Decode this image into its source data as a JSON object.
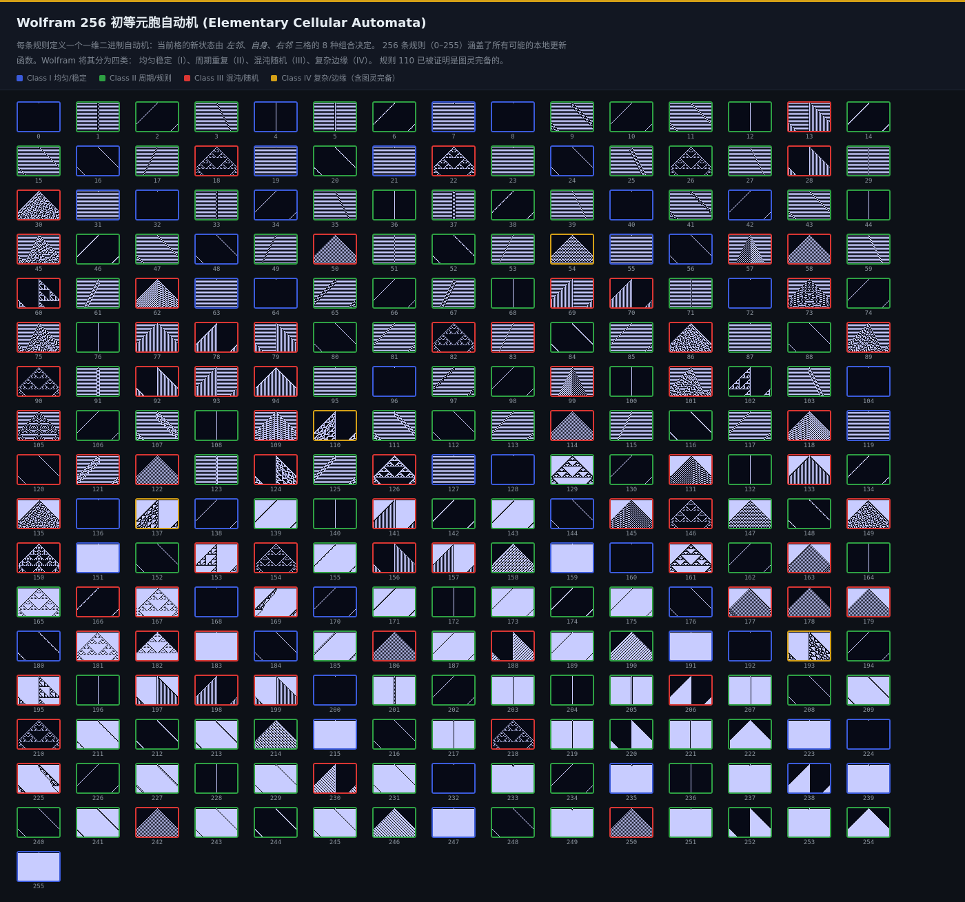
{
  "header": {
    "title": "Wolfram 256 初等元胞自动机 (Elementary Cellular Automata)",
    "desc_part1": "每条规则定义一个一维二进制自动机：当前格的新状态由 ",
    "desc_left": "左邻",
    "desc_sep1": "、",
    "desc_self": "自身",
    "desc_sep2": "、",
    "desc_right": "右邻",
    "desc_part2": " 三格的 8 种组合决定。 256 条规则（0–255）涵盖了所有可能的本地更新函数。Wolfram 将其分为四类： 均匀稳定（I）、周期重复（II）、混沌随机（III）、复杂边缘（IV）。 规则 110 已被证明是图灵完备的。"
  },
  "legend": [
    {
      "label": "Class I  均匀/稳定",
      "color": "#3b5bdb"
    },
    {
      "label": "Class II 周期/规则",
      "color": "#2ea043"
    },
    {
      "label": "Class III 混沌/随机",
      "color": "#da3633"
    },
    {
      "label": "Class IV 复杂/边缘（含图灵完备）",
      "color": "#d4a017"
    }
  ],
  "class_colors": {
    "1": "#3b5bdb",
    "2": "#2ea043",
    "3": "#da3633",
    "4": "#d4a017"
  },
  "cell_colors": {
    "on": "#c8ccff",
    "off": "#070a16"
  },
  "class3_rules": [
    13,
    18,
    22,
    28,
    30,
    45,
    50,
    57,
    58,
    60,
    62,
    69,
    70,
    73,
    75,
    77,
    78,
    79,
    82,
    83,
    86,
    89,
    90,
    92,
    93,
    94,
    99,
    101,
    105,
    109,
    114,
    118,
    120,
    121,
    122,
    124,
    126,
    131,
    133,
    135,
    141,
    145,
    146,
    149,
    150,
    153,
    154,
    156,
    157,
    161,
    163,
    166,
    167,
    169,
    177,
    178,
    179,
    181,
    182,
    183,
    186,
    188,
    195,
    197,
    198,
    199,
    206,
    210,
    218,
    225,
    230,
    242,
    250
  ],
  "class4_rules": [
    54,
    110,
    137,
    193
  ],
  "class2_rules": [
    1,
    2,
    3,
    5,
    6,
    9,
    10,
    11,
    12,
    14,
    15,
    17,
    20,
    23,
    25,
    26,
    27,
    29,
    33,
    35,
    36,
    37,
    38,
    39,
    41,
    43,
    44,
    46,
    47,
    49,
    51,
    52,
    53,
    59,
    61,
    65,
    66,
    67,
    68,
    71,
    74,
    76,
    80,
    81,
    84,
    85,
    87,
    88,
    91,
    95,
    97,
    98,
    100,
    102,
    103,
    106,
    107,
    108,
    111,
    112,
    113,
    115,
    116,
    117,
    123,
    125,
    129,
    130,
    132,
    134,
    139,
    140,
    142,
    143,
    147,
    148,
    152,
    155,
    158,
    162,
    164,
    165,
    171,
    172,
    173,
    174,
    175,
    185,
    187,
    189,
    190,
    194,
    196,
    201,
    202,
    203,
    204,
    205,
    207,
    208,
    209,
    211,
    212,
    213,
    214,
    216,
    217,
    219,
    220,
    221,
    222,
    226,
    227,
    228,
    229,
    231,
    233,
    234,
    236,
    237,
    240,
    241,
    243,
    244,
    245,
    246,
    248,
    249,
    251,
    252,
    253,
    254
  ],
  "rules_count": 256
}
